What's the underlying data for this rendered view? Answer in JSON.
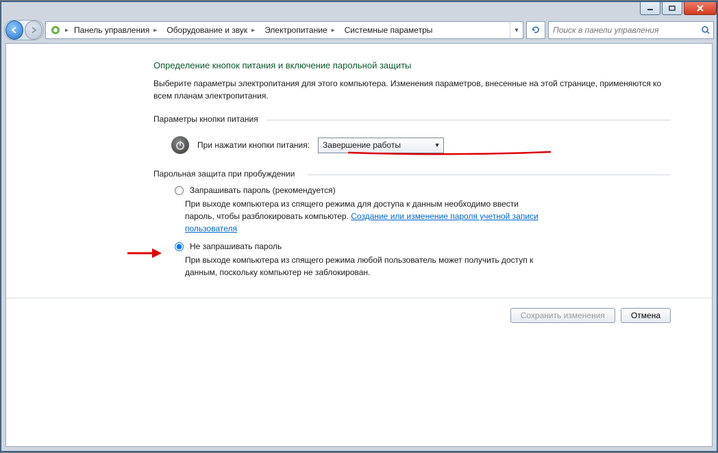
{
  "titlebar": {
    "minimize": "_",
    "maximize": "□",
    "close": "✕"
  },
  "breadcrumbs": {
    "items": [
      "Панель управления",
      "Оборудование и звук",
      "Электропитание",
      "Системные параметры"
    ]
  },
  "search": {
    "placeholder": "Поиск в панели управления"
  },
  "heading": "Определение кнопок питания и включение парольной защиты",
  "subtext": "Выберите параметры электропитания для этого компьютера. Изменения параметров, внесенные на этой странице, применяются ко всем планам электропитания.",
  "group1_label": "Параметры кнопки питания",
  "power_label": "При нажатии кнопки питания:",
  "power_value": "Завершение работы",
  "group2_label": "Парольная защита при пробуждении",
  "opt1": {
    "label": "Запрашивать пароль (рекомендуется)",
    "desc_pre": "При выходе компьютера из спящего режима для доступа к данным необходимо ввести пароль, чтобы разблокировать компьютер. ",
    "link": "Создание или изменение пароля учетной записи пользователя"
  },
  "opt2": {
    "label": "Не запрашивать пароль",
    "desc": "При выходе компьютера из спящего режима любой пользователь может получить доступ к данным, поскольку компьютер не заблокирован."
  },
  "buttons": {
    "save": "Сохранить изменения",
    "cancel": "Отмена"
  }
}
